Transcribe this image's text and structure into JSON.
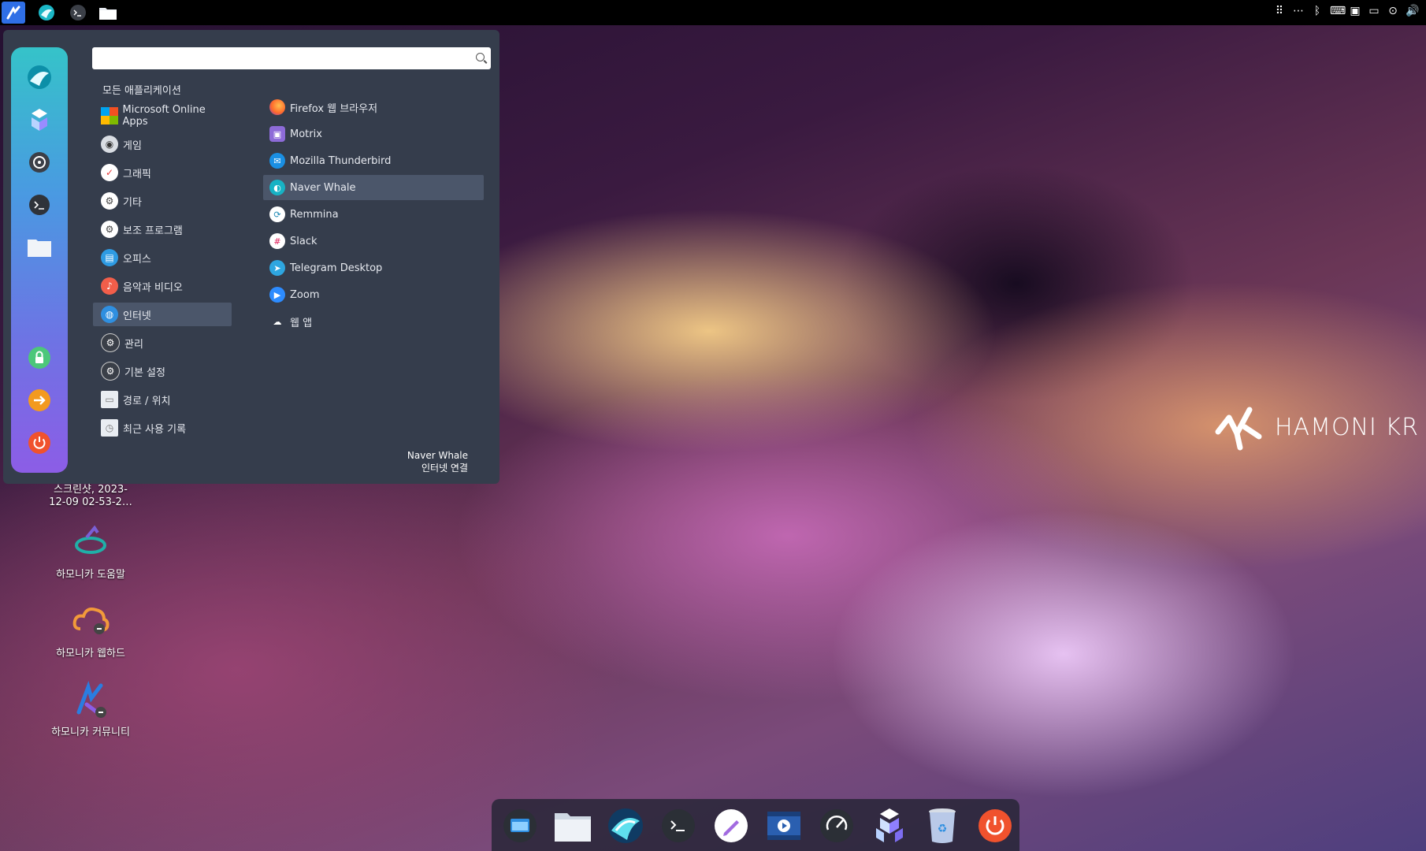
{
  "top_panel": {
    "launchers": [
      "hamonikr-menu-icon",
      "whale-browser-icon",
      "terminal-icon",
      "files-icon"
    ],
    "tray": [
      "apps-grid-icon",
      "more-icon",
      "bluetooth-icon",
      "keyboard-icon",
      "monitor-icon",
      "battery-icon",
      "network-icon",
      "volume-icon"
    ]
  },
  "menu": {
    "search": {
      "value": "",
      "placeholder": ""
    },
    "all_apps_label": "모든 애플리케이션",
    "categories": [
      {
        "label": "Microsoft Online Apps",
        "icon": "microsoft-icon"
      },
      {
        "label": "게임",
        "icon": "gamepad-icon"
      },
      {
        "label": "그래픽",
        "icon": "graphics-icon"
      },
      {
        "label": "기타",
        "icon": "gear-icon"
      },
      {
        "label": "보조 프로그램",
        "icon": "accessories-icon"
      },
      {
        "label": "오피스",
        "icon": "office-icon"
      },
      {
        "label": "음악과 비디오",
        "icon": "music-icon"
      },
      {
        "label": "인터넷",
        "icon": "internet-icon"
      },
      {
        "label": "관리",
        "icon": "admin-icon"
      },
      {
        "label": "기본 설정",
        "icon": "settings-icon"
      },
      {
        "label": "경로 / 위치",
        "icon": "folder-icon"
      },
      {
        "label": "최근 사용 기록",
        "icon": "recent-icon"
      }
    ],
    "selected_category": "인터넷",
    "apps": [
      {
        "label": "Firefox 웹 브라우저",
        "icon": "firefox-icon"
      },
      {
        "label": "Motrix",
        "icon": "motrix-icon"
      },
      {
        "label": "Mozilla Thunderbird",
        "icon": "thunderbird-icon"
      },
      {
        "label": "Naver Whale",
        "icon": "whale-icon"
      },
      {
        "label": "Remmina",
        "icon": "remmina-icon"
      },
      {
        "label": "Slack",
        "icon": "slack-icon"
      },
      {
        "label": "Telegram Desktop",
        "icon": "telegram-icon"
      },
      {
        "label": "Zoom",
        "icon": "zoom-icon"
      },
      {
        "label": "웹 앱",
        "icon": "web-app-icon"
      }
    ],
    "selected_app": "Naver Whale",
    "description": {
      "name": "Naver Whale",
      "subtitle": "인터넷 연결"
    },
    "sidebar": [
      "whale-icon",
      "software-center-icon",
      "settings-icon",
      "terminal-icon",
      "folder-icon",
      "lock-icon",
      "logout-icon",
      "power-icon"
    ]
  },
  "desktop": {
    "icons": [
      {
        "label": "스크린샷, 2023-12-09 02-53-2…",
        "icon": "screenshot-icon"
      },
      {
        "label": "하모니카 도움말",
        "icon": "help-icon"
      },
      {
        "label": "하모니카 웹하드",
        "icon": "webhard-icon"
      },
      {
        "label": "하모니카 커뮤니티",
        "icon": "community-icon"
      }
    ],
    "brand": "HAMONI KR"
  },
  "dock": {
    "items": [
      "screenshot-tool-icon",
      "files-icon",
      "whale-browser-icon",
      "terminal-icon",
      "text-editor-icon",
      "video-player-icon",
      "system-monitor-icon",
      "software-center-icon",
      "trash-icon",
      "power-icon"
    ]
  },
  "colors": {
    "panel": "#000000",
    "menu_bg": "#353d4c",
    "selection": "#4b566a"
  }
}
